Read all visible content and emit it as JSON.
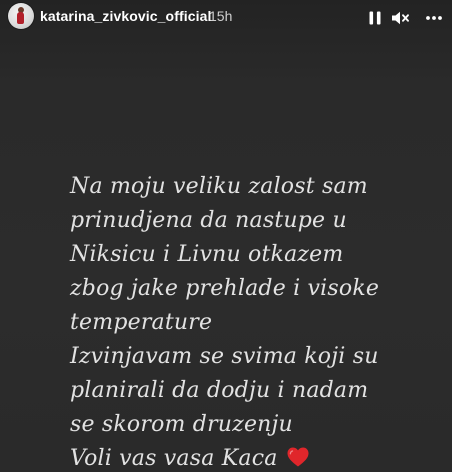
{
  "header": {
    "username": "katarina_zivkovic_official",
    "time_ago": "15h",
    "controls": {
      "pause": "pause-icon",
      "mute": "speaker-muted-icon",
      "more": "more-horizontal-icon"
    }
  },
  "caption": {
    "lines": [
      "Na moju veliku zalost sam",
      "prinudjena da nastupe u",
      "Niksicu i Livnu otkazem",
      "zbog jake prehlade i visoke",
      "temperature",
      "Izvinjavam se svima koji su",
      "planirali da dodju i nadam",
      "se skorom druzenju",
      "Voli vas vasa Kaca"
    ],
    "emoji": "heart-emoji"
  },
  "colors": {
    "background": "#2b2b2b",
    "text": "#e2e2e2",
    "heart": "#e0262b"
  }
}
